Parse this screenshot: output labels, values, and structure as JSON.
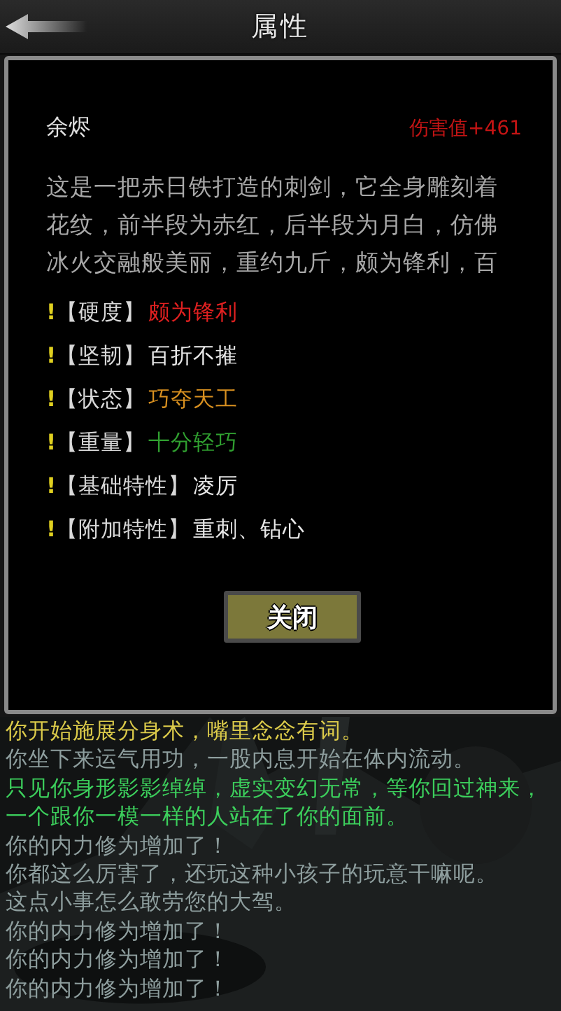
{
  "header": {
    "title": "属性"
  },
  "item": {
    "name": "余烬",
    "damage": "伤害值+461",
    "description": [
      "这是一把赤日铁打造的刺剑，它全身雕刻着",
      "花纹，前半段为赤红，后半段为月白，仿佛",
      "冰火交融般美丽，重约九斤，颇为锋利，百"
    ],
    "attributes": [
      {
        "mark": "!",
        "label": "【硬度】",
        "value": "颇为锋利",
        "color": "#e02020"
      },
      {
        "mark": "!",
        "label": "【坚韧】",
        "value": "百折不摧",
        "color": "#e8e8e8"
      },
      {
        "mark": "!",
        "label": "【状态】",
        "value": "巧夺天工",
        "color": "#d89020"
      },
      {
        "mark": "!",
        "label": "【重量】",
        "value": "十分轻巧",
        "color": "#30a030"
      },
      {
        "mark": "!",
        "label": "【基础特性】",
        "value": "凌厉",
        "color": "#e8e8e8"
      },
      {
        "mark": "!",
        "label": "【附加特性】",
        "value": "重刺、钻心",
        "color": "#e8e8e8"
      }
    ],
    "close_button": "关闭"
  },
  "log": [
    {
      "text": "你开始施展分身术，嘴里念念有词。",
      "kind": "skill"
    },
    {
      "text": "你坐下来运气用功，一股内息开始在体内流动。",
      "kind": "info"
    },
    {
      "text": "只见你身形影影绰绰，虚实变幻无常，等你回过神来，一个跟你一模一样的人站在了你的面前。",
      "kind": "effect"
    },
    {
      "text": "你的内力修为增加了！",
      "kind": "info"
    },
    {
      "text": "你都这么厉害了，还玩这种小孩子的玩意干嘛呢。",
      "kind": "info"
    },
    {
      "text": "这点小事怎么敢劳您的大驾。",
      "kind": "info"
    },
    {
      "text": "你的内力修为增加了！",
      "kind": "info"
    },
    {
      "text": "你的内力修为增加了！",
      "kind": "info"
    },
    {
      "text": "你的内力修为增加了！",
      "kind": "info"
    }
  ]
}
